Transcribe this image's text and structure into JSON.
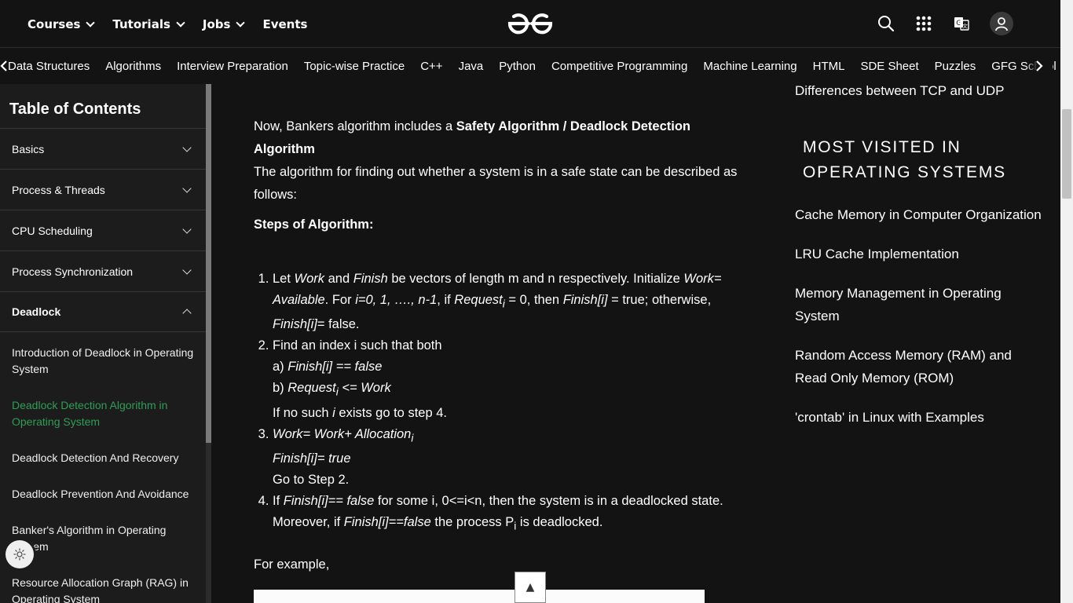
{
  "header": {
    "nav": [
      {
        "label": "Courses",
        "dropdown": true
      },
      {
        "label": "Tutorials",
        "dropdown": true
      },
      {
        "label": "Jobs",
        "dropdown": true
      },
      {
        "label": "Events",
        "dropdown": false
      }
    ],
    "icons": [
      "search-icon",
      "apps-grid-icon",
      "translate-icon",
      "user-avatar-icon"
    ]
  },
  "subnav": {
    "items": [
      "Data Structures",
      "Algorithms",
      "Interview Preparation",
      "Topic-wise Practice",
      "C++",
      "Java",
      "Python",
      "Competitive Programming",
      "Machine Learning",
      "HTML",
      "SDE Sheet",
      "Puzzles",
      "GFG School"
    ]
  },
  "sidebar": {
    "title": "Table of Contents",
    "sections": [
      {
        "label": "Basics"
      },
      {
        "label": "Process & Threads"
      },
      {
        "label": "CPU Scheduling"
      },
      {
        "label": "Process Synchronization"
      },
      {
        "label": "Deadlock"
      }
    ],
    "deadlock_items": [
      "Introduction of Deadlock in Operating System",
      "Deadlock Detection Algorithm in Operating System",
      "Deadlock Detection And Recovery",
      "Deadlock Prevention And Avoidance",
      "Banker's Algorithm in Operating System",
      "Resource Allocation Graph (RAG) in Operating System"
    ]
  },
  "article": {
    "p1_pre": "Now, Bankers algorithm includes a ",
    "p1_bold": "Safety Algorithm / Deadlock Detection Algorithm",
    "p2": "The algorithm for finding out whether a system is in a safe state can be described as follows:",
    "steps_title": "Steps of Algorithm:",
    "example": "For example,"
  },
  "right": {
    "top_link": "Differences between TCP and UDP",
    "most_visited_title": "MOST VISITED IN OPERATING SYSTEMS",
    "links": [
      "Cache Memory in Computer Organization",
      "LRU Cache Implementation",
      "Memory Management in Operating System",
      "Random Access Memory (RAM) and Read Only Memory (ROM)",
      "'crontab' in Linux with Examples"
    ]
  },
  "controls": {
    "scroll_top": "▲"
  },
  "colors": {
    "background": "#131313",
    "sidebar": "#1c1c1c",
    "accent_green": "#2f9e57",
    "text": "#ffffff"
  }
}
